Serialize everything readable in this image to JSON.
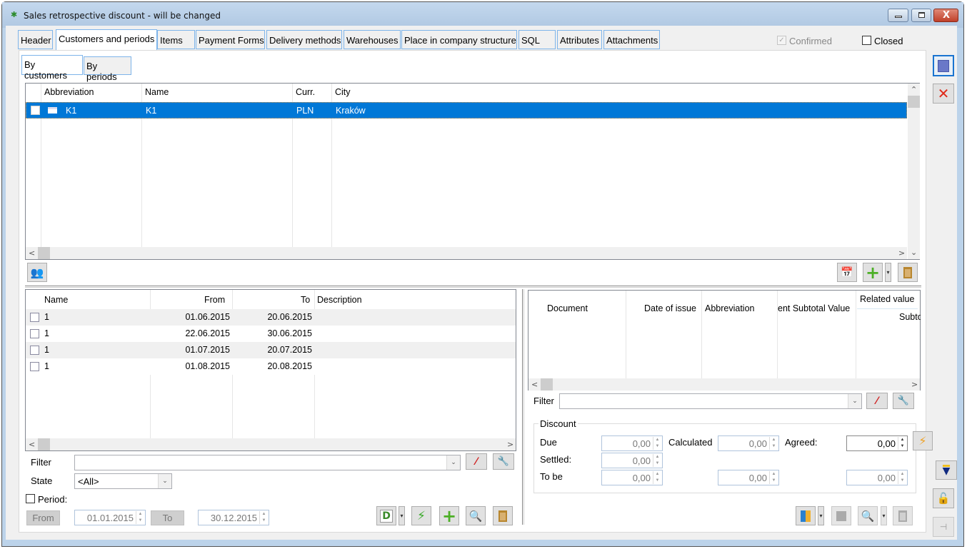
{
  "window": {
    "title": "Sales retrospective discount - will be changed",
    "icon": "app-icon",
    "controls": [
      "minimize",
      "maximize",
      "close"
    ]
  },
  "tabs": [
    {
      "label": "Header",
      "active": false
    },
    {
      "label": "Customers and periods",
      "active": true
    },
    {
      "label": "Items",
      "active": false
    },
    {
      "label": "Payment Forms",
      "active": false
    },
    {
      "label": "Delivery methods",
      "active": false
    },
    {
      "label": "Warehouses",
      "active": false
    },
    {
      "label": "Place in company structure",
      "active": false
    },
    {
      "label": "SQL",
      "active": false
    },
    {
      "label": "Attributes",
      "active": false
    },
    {
      "label": "Attachments",
      "active": false
    }
  ],
  "flags": {
    "confirmed": {
      "label": "Confirmed",
      "checked": true,
      "disabled": true
    },
    "closed": {
      "label": "Closed",
      "checked": false
    }
  },
  "subtabs": [
    {
      "label": "By customers",
      "active": true
    },
    {
      "label": "By periods",
      "active": false
    }
  ],
  "customers": {
    "columns": [
      "Abbreviation",
      "Name",
      "Curr.",
      "City"
    ],
    "rows": [
      {
        "abbreviation": "K1",
        "name": "K1",
        "currency": "PLN",
        "city": "Kraków",
        "selected": true
      }
    ]
  },
  "periods": {
    "columns": [
      "Name",
      "From",
      "To",
      "Description"
    ],
    "rows": [
      {
        "name": "1",
        "from": "01.06.2015",
        "to": "20.06.2015",
        "description": ""
      },
      {
        "name": "1",
        "from": "22.06.2015",
        "to": "30.06.2015",
        "description": ""
      },
      {
        "name": "1",
        "from": "01.07.2015",
        "to": "20.07.2015",
        "description": ""
      },
      {
        "name": "1",
        "from": "01.08.2015",
        "to": "20.08.2015",
        "description": ""
      }
    ]
  },
  "periods_filter": {
    "filter_label": "Filter",
    "filter_value": "",
    "state_label": "State",
    "state_value": "<All>",
    "period_label": "Period:",
    "period_checked": false,
    "from_label": "From",
    "from_value": "01.01.2015",
    "to_label": "To",
    "to_value": "30.12.2015"
  },
  "documents": {
    "columns": [
      "Document",
      "Date of issue",
      "Abbreviation",
      "ent Subtotal Value",
      "Related value",
      "Subto"
    ],
    "rows": []
  },
  "documents_filter": {
    "filter_label": "Filter",
    "filter_value": ""
  },
  "discount": {
    "legend": "Discount",
    "due_label": "Due",
    "due_value": "0,00",
    "calculated_label": "Calculated",
    "calculated_value": "0,00",
    "agreed_label": "Agreed:",
    "agreed_value": "0,00",
    "settled_label": "Settled:",
    "settled_value": "0,00",
    "tobe_label": "To be",
    "tobe_value": "0,00",
    "tobe_calculated_value": "0,00",
    "tobe_agreed_value": "0,00"
  }
}
